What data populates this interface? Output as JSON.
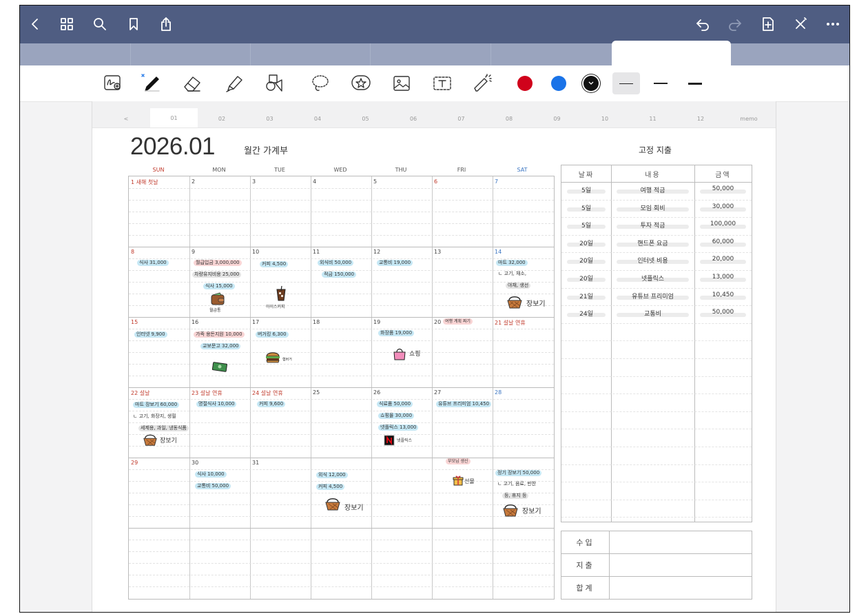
{
  "toolbar_icons": {
    "back": "chevron-left-icon",
    "grid": "grid-icon",
    "search": "search-icon",
    "bookmark": "bookmark-icon",
    "share": "share-icon",
    "undo": "undo-icon",
    "redo": "redo-icon",
    "add_page": "add-page-icon",
    "close": "close-pen-icon",
    "more": "more-icon"
  },
  "pen_colors": [
    "#d0021b",
    "#1a73e8",
    "#111111"
  ],
  "month_tabs": [
    "<",
    "01",
    "02",
    "03",
    "04",
    "05",
    "06",
    "07",
    "08",
    "09",
    "10",
    "11",
    "12",
    "memo"
  ],
  "header": {
    "year_month": "2026.01",
    "subtitle": "월간 가계부",
    "fixed_title": "고정 지출"
  },
  "weekdays": [
    "SUN",
    "MON",
    "TUE",
    "WED",
    "THU",
    "FRI",
    "SAT"
  ],
  "weeks": [
    [
      "1 새해 첫날",
      "2",
      "3",
      "4",
      "5",
      "6",
      "7"
    ],
    [
      "8",
      "9",
      "10",
      "11",
      "12",
      "13",
      "14"
    ],
    [
      "15",
      "16",
      "17",
      "18",
      "19",
      "20",
      "21 설날 연휴"
    ],
    [
      "22 설날",
      "23 설날 연휴",
      "24 설날 연휴",
      "25",
      "26",
      "27",
      "28"
    ],
    [
      "29",
      "30",
      "31",
      "",
      "",
      "",
      ""
    ]
  ],
  "notes": {
    "w2": [
      "식사 31,000",
      "월급입금 3,000,000",
      "차량유지비용 25,000",
      "식사 15,000",
      "커피 4,500",
      "외식비 50,000",
      "적금 150,000",
      "교통비 19,000",
      "마트 32,000",
      "ㄴ 고기, 채소,",
      "야채, 생선",
      "월급통",
      "아이스커피",
      "장보기"
    ],
    "w3": [
      "인터넷 9,900",
      "가족 용돈지원 10,000",
      "교보문고 32,000",
      "버거킹 6,300",
      "화장품 19,000",
      "여행 계획 짜기",
      "햄버거",
      "쇼핑"
    ],
    "w4": [
      "마트 장보기 60,000",
      "ㄴ 고기, 화장지, 생필",
      "세제용, 과일, 냉동식품",
      "장보기",
      "명절식사 10,000",
      "커피 9,600",
      "식료품 50,000",
      "쇼핑몰 30,000",
      "넷플릭스 13,000",
      "유튜브 프리미엄 10,450",
      "넷플릭스"
    ],
    "w5": [
      "식사 10,000",
      "교통비 50,000",
      "외식 12,000",
      "커피 4,500",
      "장보기",
      "부모님 생신",
      "선물",
      "정기 장보기 50,000",
      "ㄴ 고기, 음료, 반찬",
      "등, 휴지 등",
      "장보기"
    ]
  },
  "fixed": {
    "headers": [
      "날짜",
      "내용",
      "금액"
    ],
    "rows": [
      [
        "5일",
        "여행 적금",
        "50,000"
      ],
      [
        "5일",
        "모임 회비",
        "30,000"
      ],
      [
        "5일",
        "투자 적금",
        "100,000"
      ],
      [
        "20일",
        "핸드폰 요금",
        "60,000"
      ],
      [
        "20일",
        "인터넷 비용",
        "20,000"
      ],
      [
        "20일",
        "넷플릭스",
        "13,000"
      ],
      [
        "21일",
        "유튜브 프리미엄",
        "10,450"
      ],
      [
        "24일",
        "교통비",
        "50,000"
      ]
    ]
  },
  "summary": [
    "수입",
    "지출",
    "합계"
  ]
}
